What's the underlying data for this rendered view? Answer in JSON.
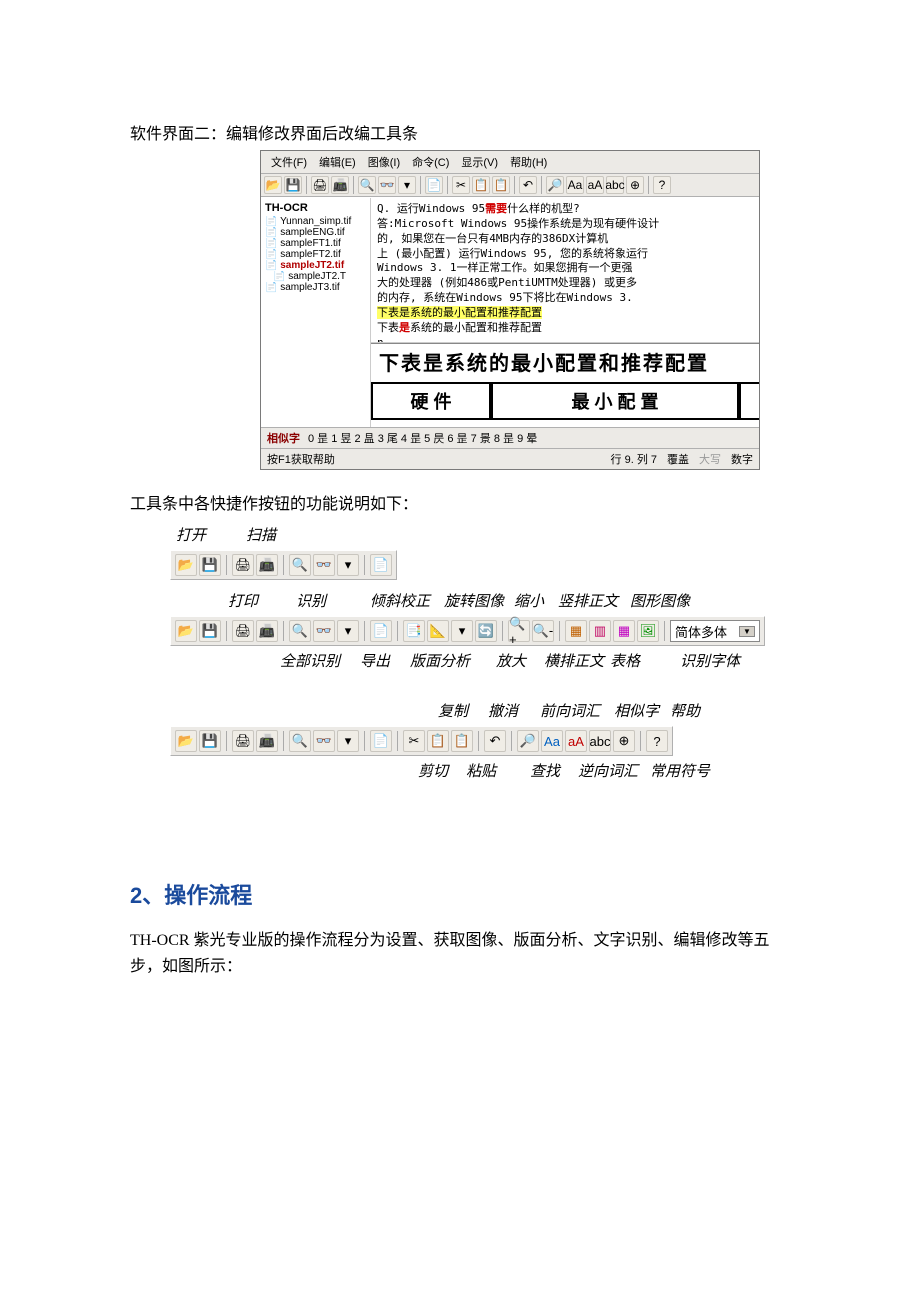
{
  "intro": "软件界面二：编辑修改界面后改编工具条",
  "app": {
    "menu": [
      "文件(F)",
      "编辑(E)",
      "图像(I)",
      "命令(C)",
      "显示(V)",
      "帮助(H)"
    ],
    "tree": {
      "root": "TH-OCR",
      "files": [
        {
          "name": "Yunnan_simp.tif",
          "selected": false
        },
        {
          "name": "sampleENG.tif",
          "selected": false
        },
        {
          "name": "sampleFT1.tif",
          "selected": false
        },
        {
          "name": "sampleFT2.tif",
          "selected": false
        },
        {
          "name": "sampleJT2.tif",
          "selected": true
        },
        {
          "name": "sampleJT2.T",
          "selected": false,
          "sub": true
        },
        {
          "name": "sampleJT3.tif",
          "selected": false
        }
      ]
    },
    "text": {
      "l1": "Q. 运行Windows 95需要什么样的机型?",
      "l1_before": "Q. 运行Windows 95",
      "l1_red": "需要",
      "l1_after": "什么样的机型?",
      "l2": "答:Microsoft Windows 95操作系统是为现有硬件设计",
      "l3": "   的, 如果您在一台只有4MB内存的386DX计算机",
      "l4": "   上 (最小配置) 运行Windows 95, 您的系统将象运行",
      "l5": "   Windows 3. 1一样正常工作。如果您拥有一个更强",
      "l6": "   大的处理器 (例如486或PentiUMTM处理器) 或更多",
      "l7": "   的内存, 系统在Windows 95下将比在Windows 3.",
      "l8": "   下表是系统的最小配置和推荐配置",
      "l9_before": "   下表",
      "l9_red": "是",
      "l9_after": "系统的最小配置和推荐配置",
      "l10": "n"
    },
    "image": {
      "headline": "下表昰系统的最小配置和推荐配置",
      "cell1": "硬 件",
      "cell2": "最 小 配 置"
    },
    "status1": {
      "label": "相似字",
      "candidates": "0 昰  1 昱  2 昷  3 尾  4 昰  5 昃  6 昰  7 景  8 昰  9 晕"
    },
    "status2": {
      "help": "按F1获取帮助",
      "pos": "行 9. 列 7",
      "over": "覆盖",
      "caps": "大写",
      "num": "数字"
    }
  },
  "fig_caption": "工具条中各快捷作按钮的功能说明如下：",
  "fig1": {
    "labels_top": {
      "open": "打开",
      "scan": "扫描"
    }
  },
  "fig2": {
    "labels_top": {
      "print": "打印",
      "recognize": "识别",
      "deskew": "倾斜校正",
      "rotate": "旋转图像",
      "zoomout": "缩小",
      "vert_text": "竖排正文",
      "graphic_image": "图形图像"
    },
    "select": "简体多体",
    "labels_bottom": {
      "recognize_all": "全部识别",
      "export": "导出",
      "layout": "版面分析",
      "zoomin": "放大",
      "horiz_text": "横排正文",
      "table": "表格",
      "font": "识别字体"
    }
  },
  "fig3": {
    "labels_top": {
      "copy": "复制",
      "undo": "撤消",
      "fwd_vocab": "前向词汇",
      "similar": "相似字",
      "help": "帮助"
    },
    "labels_bottom": {
      "cut": "剪切",
      "paste": "粘贴",
      "find": "查找",
      "rev_vocab": "逆向词汇",
      "common": "常用符号"
    }
  },
  "section": {
    "num": "2",
    "title": "、操作流程",
    "para": "TH-OCR 紫光专业版的操作流程分为设置、获取图像、版面分析、文字识别、编辑修改等五步，如图所示："
  }
}
